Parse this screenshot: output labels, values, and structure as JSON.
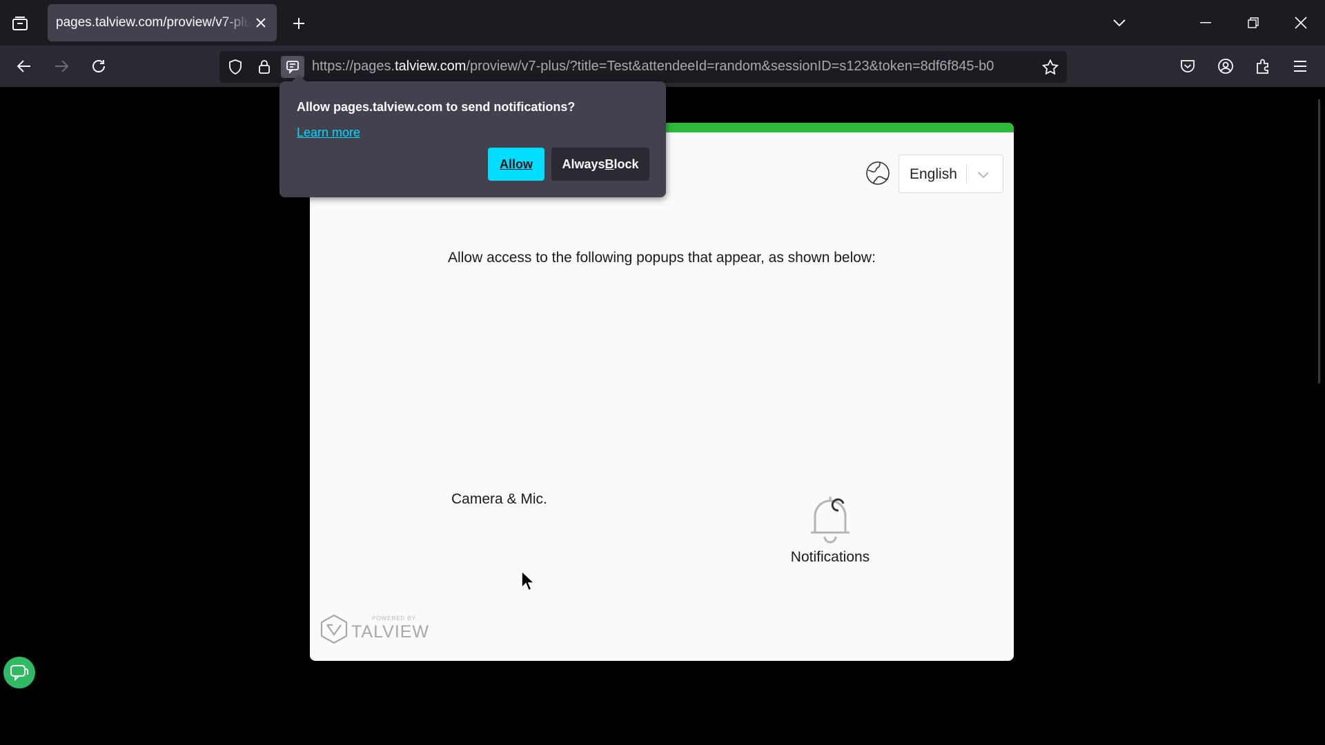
{
  "browser": {
    "tab": {
      "title": "pages.talview.com/proview/v7-plus/?title=Test&attendeeId=random&sessionID=s123&token=8df6f845-b0",
      "close_icon": "close-icon"
    },
    "tabbar_icons": {
      "tab_list": "tab-list-icon",
      "new_tab": "plus-icon",
      "list_all_tabs": "chevron-down-icon",
      "minimize": "minimize-icon",
      "restore": "restore-icon",
      "close": "close-icon"
    },
    "nav_icons": {
      "back": "arrow-left-icon",
      "forward": "arrow-right-icon",
      "reload": "reload-icon"
    },
    "urlbar": {
      "url_prefix": "https://pages.",
      "url_host": "talview.com",
      "url_rest": "/proview/v7-plus/?title=Test&attendeeId=random&sessionID=s123&token=8df6f845-b0",
      "icons": [
        "shield-icon",
        "lock-icon",
        "notification-permission-icon",
        "bookmark-star-icon"
      ]
    },
    "toolbar_icons": [
      "pocket-icon",
      "account-icon",
      "extensions-icon",
      "menu-icon"
    ]
  },
  "notification_popup": {
    "message": "Allow pages.talview.com to send notifications?",
    "learn_more": "Learn more",
    "allow_label": "Allow",
    "block_label_pre": "Always ",
    "block_label_key": "B",
    "block_label_post": "lock"
  },
  "page": {
    "language": {
      "selected": "English",
      "icon": "globe-icon"
    },
    "instruction": "Allow access to the following popups that appear, as shown below:",
    "camera_label": "Camera & Mic.",
    "notifications_label": "Notifications",
    "brand": {
      "powered_by": "POWERED BY",
      "name": "TALVIEW"
    }
  },
  "colors": {
    "accent_green": "#2fba3c",
    "allow_button": "#00ddff",
    "chrome_dark": "#1c1b22",
    "chrome_mid": "#2b2a33"
  }
}
